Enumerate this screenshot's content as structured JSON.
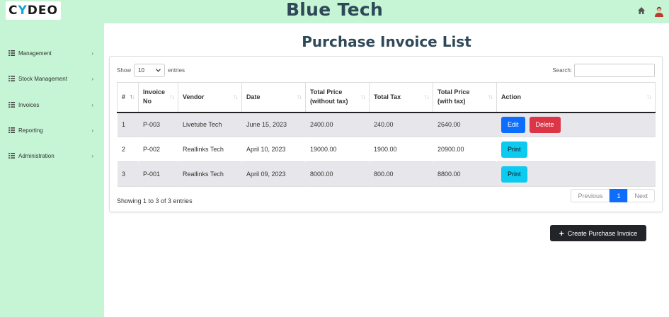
{
  "header": {
    "logo_prefix": "C",
    "logo_accent": "Y",
    "logo_suffix": "DEO",
    "brand": "Blue Tech",
    "home_icon": "home-icon",
    "avatar_icon": "user-avatar"
  },
  "sidebar": {
    "items": [
      {
        "label": "Management"
      },
      {
        "label": "Stock Management"
      },
      {
        "label": "Invoices"
      },
      {
        "label": "Reporting"
      },
      {
        "label": "Administration"
      }
    ],
    "chevron": "›"
  },
  "page": {
    "title": "Purchase Invoice List"
  },
  "table_controls": {
    "show_label": "Show",
    "entries_value": "10",
    "entries_label": "entries",
    "search_label": "Search:",
    "search_value": ""
  },
  "table": {
    "headers": [
      "#",
      "Invoice No",
      "Vendor",
      "Date",
      "Total Price (without tax)",
      "Total Tax",
      "Total Price (with tax)",
      "Action"
    ],
    "rows": [
      {
        "num": "1",
        "invoice": "P-003",
        "vendor": "Livetube Tech",
        "date": "June 15, 2023",
        "price_wo": "2400.00",
        "tax": "240.00",
        "price_w": "2640.00"
      },
      {
        "num": "2",
        "invoice": "P-002",
        "vendor": "Reallinks Tech",
        "date": "April 10, 2023",
        "price_wo": "19000.00",
        "tax": "1900.00",
        "price_w": "20900.00"
      },
      {
        "num": "3",
        "invoice": "P-001",
        "vendor": "Reallinks Tech",
        "date": "April 09, 2023",
        "price_wo": "8000.00",
        "tax": "800.00",
        "price_w": "8800.00"
      }
    ],
    "edit_label": "Edit",
    "delete_label": "Delete",
    "print_label": "Print"
  },
  "footer": {
    "info": "Showing 1 to 3 of 3 entries",
    "prev": "Previous",
    "page": "1",
    "next": "Next"
  },
  "create_button": {
    "label": "Create Purchase Invoice"
  },
  "colors": {
    "header_bg": "#c5f5d4",
    "brand_text": "#2f4858",
    "edit": "#0d6efd",
    "delete": "#dc3545",
    "print": "#0dcaf0",
    "create": "#212529"
  }
}
